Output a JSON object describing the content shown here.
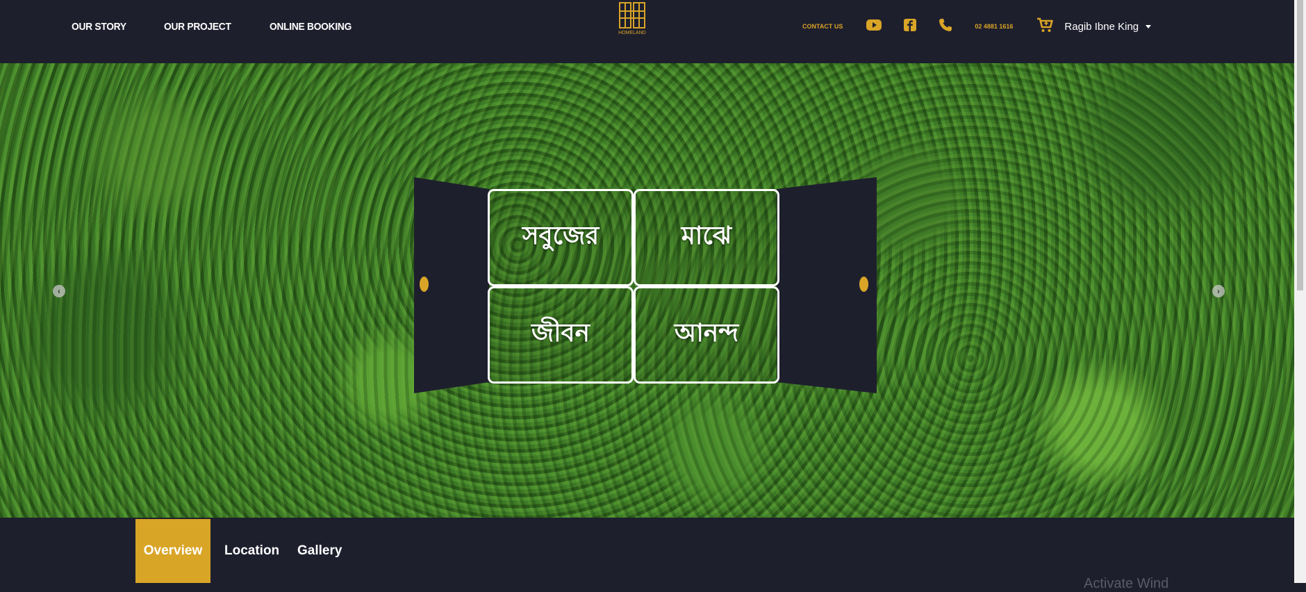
{
  "header": {
    "nav_left": [
      "OUR STORY",
      "OUR PROJECT",
      "ONLINE BOOKING"
    ],
    "logo_text": "HOMELAND",
    "contact_label": "CONTACT US",
    "phone_number": "02 4881 1616",
    "user_name": "Ragib Ibne King",
    "icons": [
      "youtube-icon",
      "facebook-icon",
      "phone-icon",
      "cart-icon",
      "chevron-down-icon"
    ],
    "accent_color": "#d9a527",
    "background_color": "#1e1f2d"
  },
  "hero": {
    "words": [
      "সবুজের",
      "মাঝে",
      "জীবন",
      "আনন্দ"
    ],
    "prev_arrow": "‹",
    "next_arrow": "›"
  },
  "tabs": [
    {
      "label": "Overview",
      "active": true
    },
    {
      "label": "Location",
      "active": false
    },
    {
      "label": "Gallery",
      "active": false
    }
  ],
  "watermark": "Activate Wind"
}
